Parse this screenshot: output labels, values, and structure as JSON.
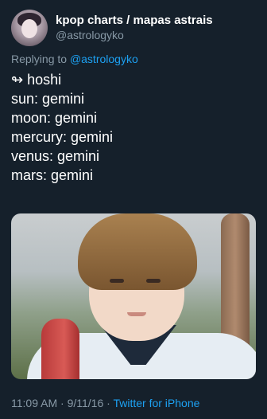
{
  "author": {
    "display_name": "kpop charts / mapas astrais",
    "handle": "@astrologyko"
  },
  "reply": {
    "prefix": "Replying to",
    "mention": "@astrologyko"
  },
  "body_lines": [
    "↬ hoshi",
    "sun: gemini",
    "moon: gemini",
    "mercury: gemini",
    "venus: gemini",
    "mars: gemini"
  ],
  "meta": {
    "time": "11:09 AM",
    "date": "9/11/16",
    "separator": "·",
    "source": "Twitter for iPhone"
  },
  "colors": {
    "background": "#15202b",
    "secondary_text": "#8899a6",
    "link": "#1da1f2"
  }
}
